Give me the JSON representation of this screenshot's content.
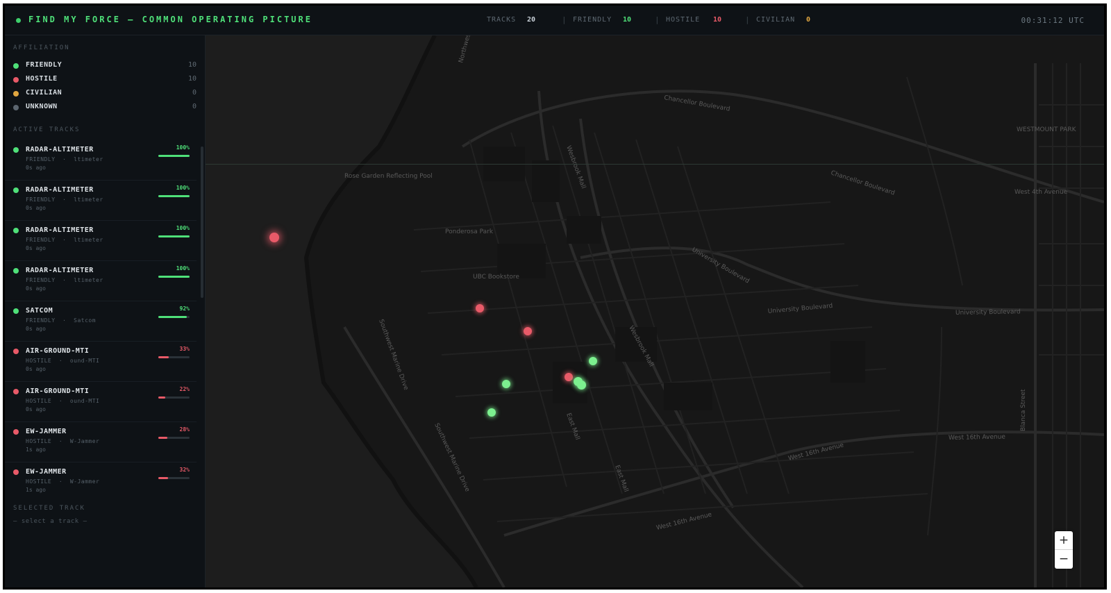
{
  "header": {
    "title": "FIND MY FORCE — COMMON OPERATING PICTURE",
    "stats": [
      {
        "label": "TRACKS",
        "value": "20",
        "color": "#c9d1d8"
      },
      {
        "label": "FRIENDLY",
        "value": "10",
        "color": "#4fe079"
      },
      {
        "label": "HOSTILE",
        "value": "10",
        "color": "#e85a68"
      },
      {
        "label": "CIVILIAN",
        "value": "0",
        "color": "#e0a640"
      }
    ],
    "separator": "|",
    "clock": "00:31:12 UTC"
  },
  "sidebar": {
    "affiliation_heading": "AFFILIATION",
    "affiliations": [
      {
        "label": "FRIENDLY",
        "count": "10",
        "color": "#4fe079"
      },
      {
        "label": "HOSTILE",
        "count": "10",
        "color": "#e85a68"
      },
      {
        "label": "CIVILIAN",
        "count": "0",
        "color": "#e0a640"
      },
      {
        "label": "UNKNOWN",
        "count": "0",
        "color": "#5c6670"
      }
    ],
    "tracks_heading": "ACTIVE TRACKS",
    "tracks": [
      {
        "name": "RADAR-ALTIMETER",
        "affiliation": "FRIENDLY",
        "source": "ltimeter",
        "age": "0s ago",
        "confidence": "100%",
        "level": 1.0,
        "color": "#4fe079"
      },
      {
        "name": "RADAR-ALTIMETER",
        "affiliation": "FRIENDLY",
        "source": "ltimeter",
        "age": "0s ago",
        "confidence": "100%",
        "level": 1.0,
        "color": "#4fe079"
      },
      {
        "name": "RADAR-ALTIMETER",
        "affiliation": "FRIENDLY",
        "source": "ltimeter",
        "age": "0s ago",
        "confidence": "100%",
        "level": 1.0,
        "color": "#4fe079"
      },
      {
        "name": "RADAR-ALTIMETER",
        "affiliation": "FRIENDLY",
        "source": "ltimeter",
        "age": "0s ago",
        "confidence": "100%",
        "level": 1.0,
        "color": "#4fe079"
      },
      {
        "name": "SATCOM",
        "affiliation": "FRIENDLY",
        "source": "Satcom",
        "age": "0s ago",
        "confidence": "92%",
        "level": 0.92,
        "color": "#4fe079"
      },
      {
        "name": "AIR-GROUND-MTI",
        "affiliation": "HOSTILE",
        "source": "ound-MTI",
        "age": "0s ago",
        "confidence": "33%",
        "level": 0.33,
        "color": "#e85a68"
      },
      {
        "name": "AIR-GROUND-MTI",
        "affiliation": "HOSTILE",
        "source": "ound-MTI",
        "age": "0s ago",
        "confidence": "22%",
        "level": 0.22,
        "color": "#e85a68"
      },
      {
        "name": "EW-JAMMER",
        "affiliation": "HOSTILE",
        "source": "W-Jammer",
        "age": "1s ago",
        "confidence": "28%",
        "level": 0.28,
        "color": "#e85a68"
      },
      {
        "name": "EW-JAMMER",
        "affiliation": "HOSTILE",
        "source": "W-Jammer",
        "age": "1s ago",
        "confidence": "32%",
        "level": 0.32,
        "color": "#e85a68"
      }
    ],
    "selected_heading": "SELECTED TRACK",
    "selected_placeholder": "— select a track —"
  },
  "map": {
    "street_labels": [
      "Chancellor Boulevard",
      "Chancellor Boulevard",
      "University Boulevard",
      "University Boulevard",
      "University Boulevard",
      "West 16th Avenue",
      "West 16th Avenue",
      "West 16th Avenue",
      "West 4th Avenue",
      "Wesbrook Mall",
      "Wesbrook Mall",
      "East Mall",
      "East Mall",
      "Northwest Marine Drive",
      "Southwest Marine Drive",
      "Southwest Marine Drive",
      "Blanca Street",
      "WESTMOUNT PARK",
      "Rose Garden Reflecting Pool",
      "Ponderosa Park",
      "UBC Bookstore"
    ],
    "zoom_in": "+",
    "zoom_out": "−"
  }
}
